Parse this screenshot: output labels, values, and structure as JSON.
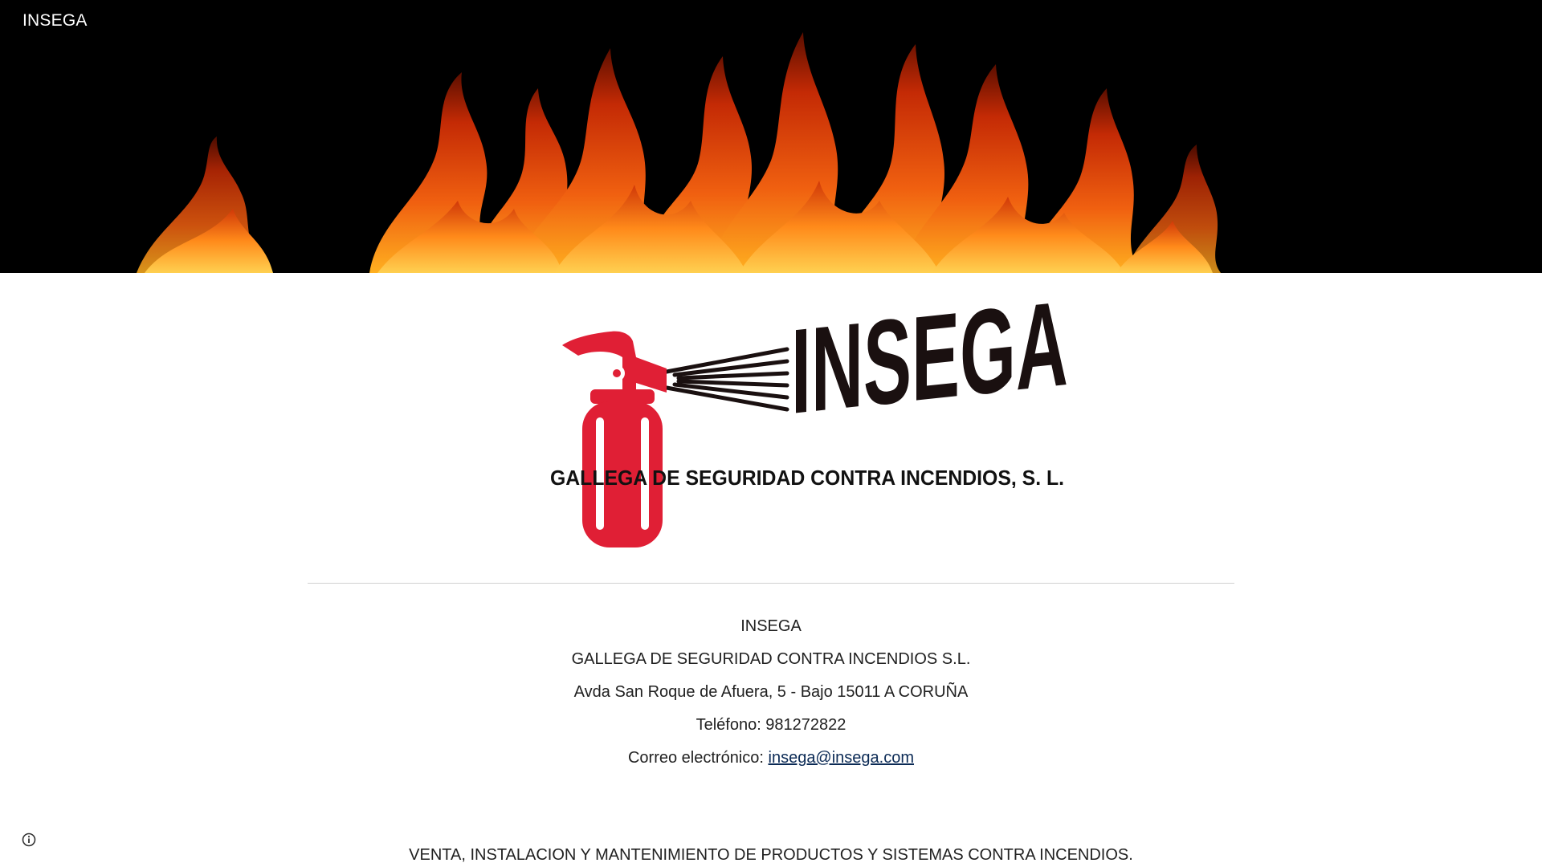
{
  "site": {
    "title": "INSEGA"
  },
  "logo": {
    "wordmark": "INSEGA",
    "subtitle": "GALLEGA DE SEGURIDAD CONTRA INCENDIOS, S. L.",
    "icon": "fire-extinguisher-icon"
  },
  "contact": {
    "name": "INSEGA",
    "company": "GALLEGA DE SEGURIDAD CONTRA INCENDIOS S.L.",
    "address": "Avda San Roque de Afuera, 5 - Bajo 15011 A CORUÑA",
    "phone": "Teléfono: 981272822",
    "email_label": "Correo electrónico: ",
    "email": "insega@insega.com"
  },
  "tagline": "VENTA, INSTALACION Y MANTENIMIENTO DE PRODUCTOS Y SISTEMAS CONTRA INCENDIOS.",
  "colors": {
    "hero_background": "#000000",
    "flame_dark": "#c42a05",
    "flame_mid": "#f06010",
    "flame_light": "#ffb020",
    "extinguisher": "#e01f35",
    "wordmark": "#1a1010",
    "link": "#0b2a55"
  },
  "icons": {
    "site_info": "info-icon"
  }
}
